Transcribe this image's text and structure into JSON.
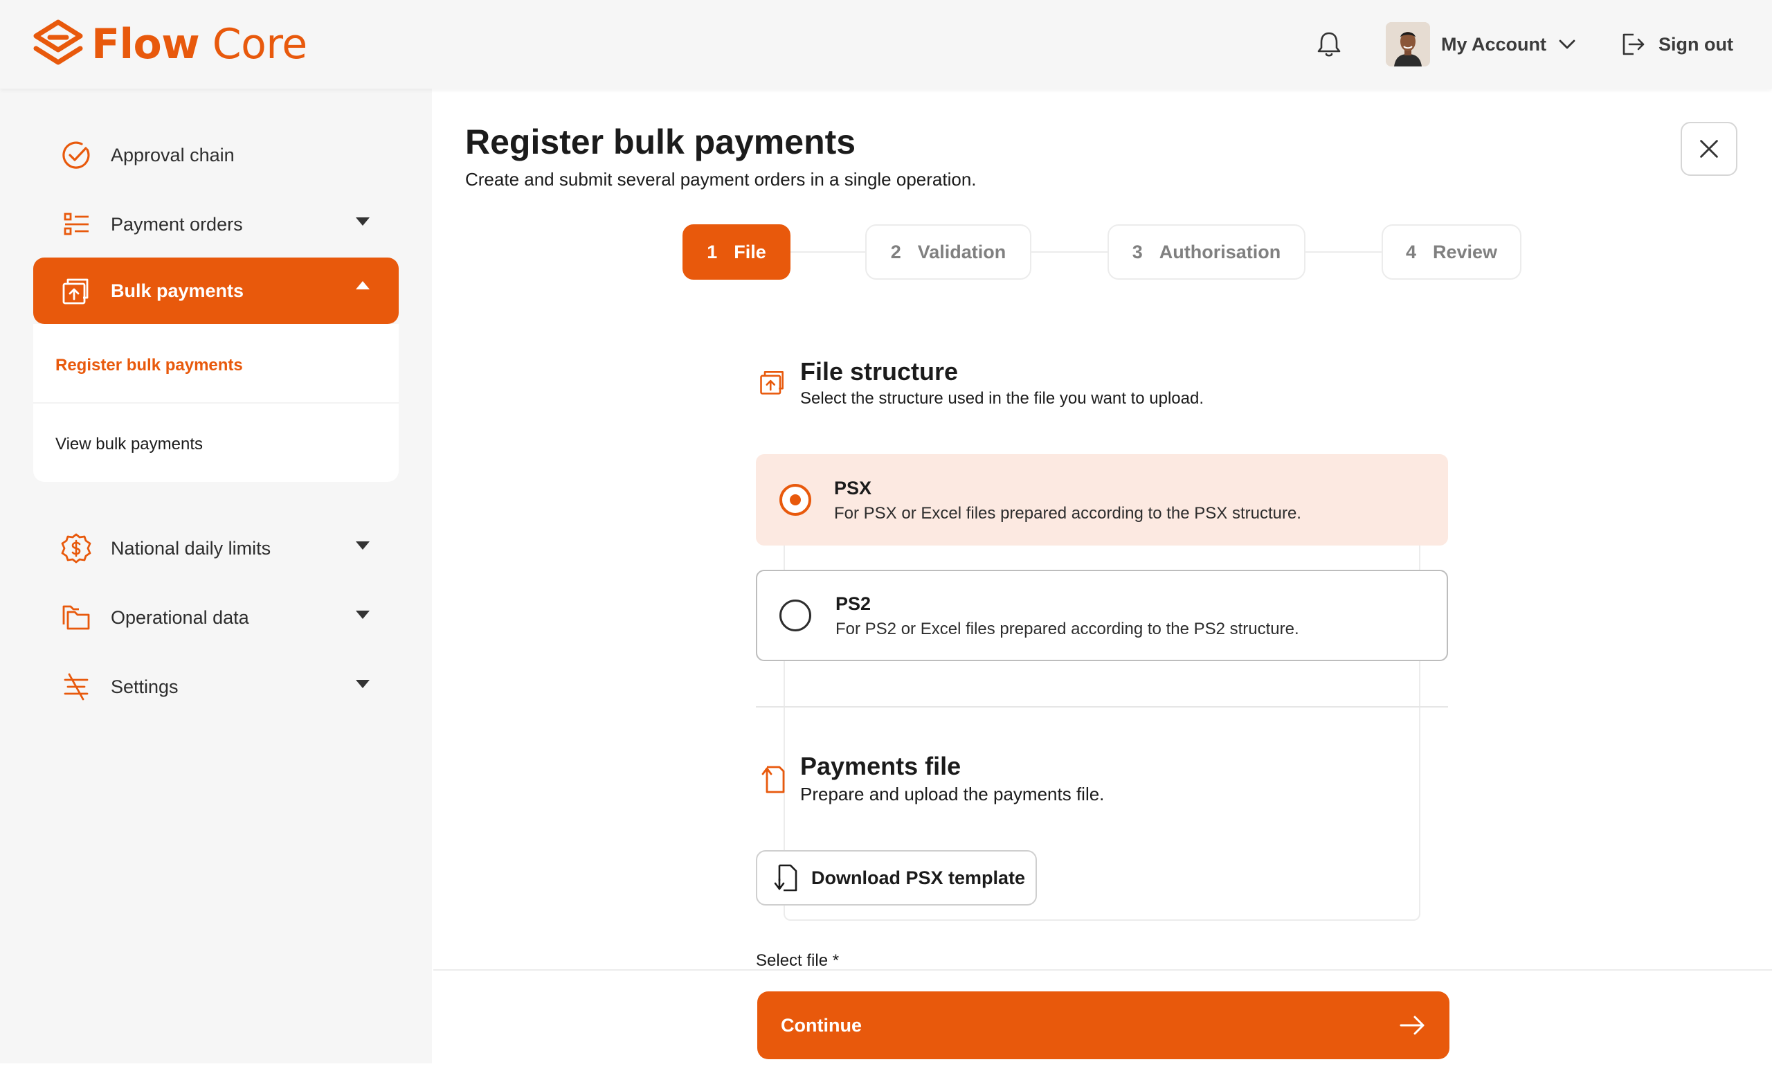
{
  "app": {
    "brand_part1": "Flow",
    "brand_part2": " Core",
    "accent_color": "#e8590c"
  },
  "header": {
    "notifications_icon": "bell-icon",
    "account_label": "My Account",
    "signout_label": "Sign out"
  },
  "sidebar": {
    "items": [
      {
        "label": "Approval chain",
        "icon": "check-circle-icon"
      },
      {
        "label": "Payment orders",
        "icon": "list-icon"
      },
      {
        "label": "Bulk payments",
        "icon": "upload-folder-icon"
      },
      {
        "label": "National daily limits",
        "icon": "dollar-badge-icon"
      },
      {
        "label": "Operational data",
        "icon": "folders-icon"
      },
      {
        "label": "Settings",
        "icon": "sliders-icon"
      }
    ],
    "bulk_subitems": [
      {
        "label": "Register bulk payments"
      },
      {
        "label": "View bulk payments"
      }
    ]
  },
  "main": {
    "title": "Register bulk payments",
    "subtitle": "Create and submit several payment orders in a single operation.",
    "steps": [
      {
        "num": "1",
        "label": "File"
      },
      {
        "num": "2",
        "label": "Validation"
      },
      {
        "num": "3",
        "label": "Authorisation"
      },
      {
        "num": "4",
        "label": "Review"
      }
    ],
    "file_structure": {
      "title": "File structure",
      "desc": "Select the structure used in the file you want to upload.",
      "options": [
        {
          "title": "PSX",
          "desc": "For PSX or Excel files prepared according to the PSX structure.",
          "selected": true
        },
        {
          "title": "PS2",
          "desc": "For PS2 or Excel files prepared according to the PS2 structure.",
          "selected": false
        }
      ]
    },
    "payments_file": {
      "title": "Payments file",
      "desc": "Prepare and upload the payments file.",
      "download_label": "Download PSX template",
      "select_label": "Select file *"
    },
    "continue_label": "Continue"
  }
}
